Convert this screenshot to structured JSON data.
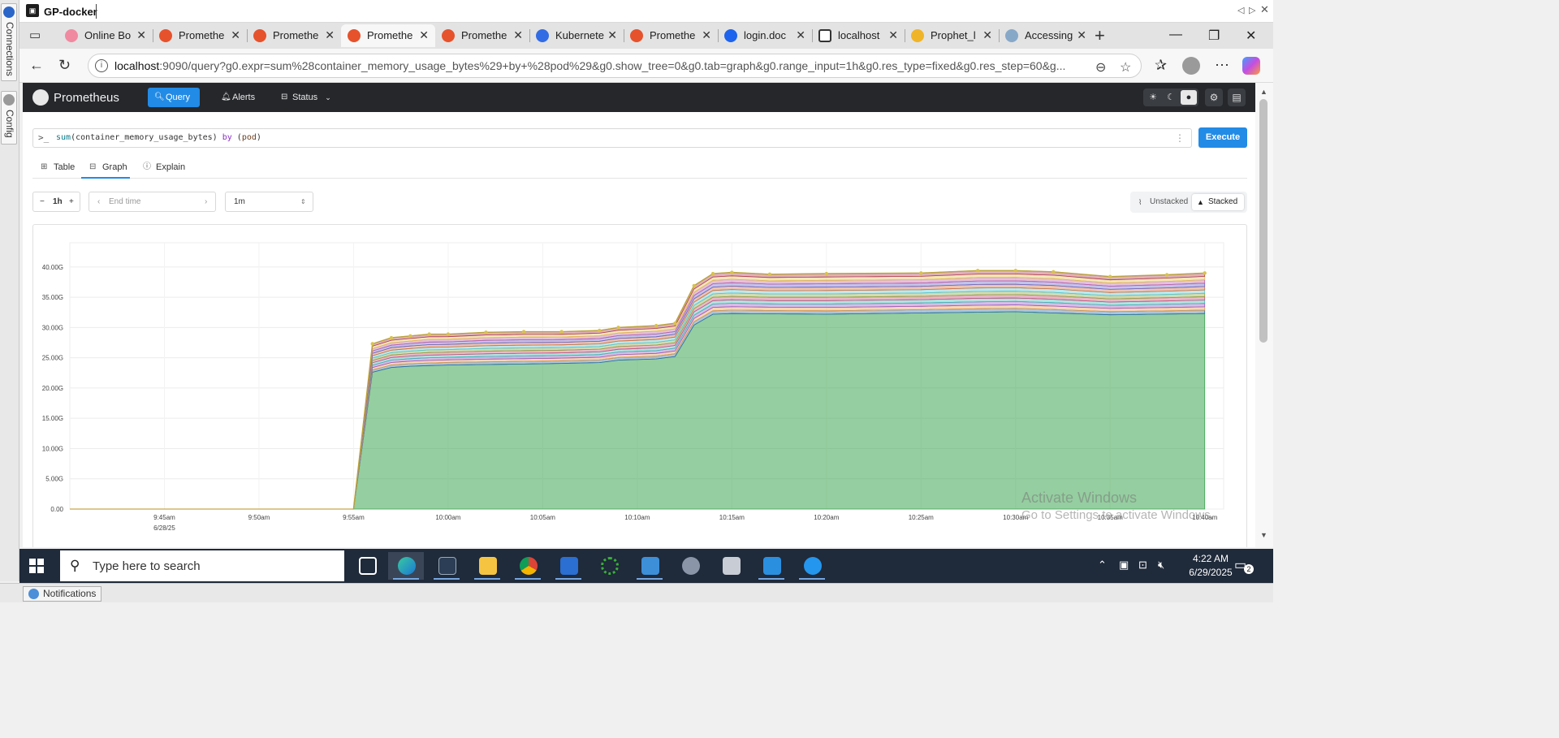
{
  "side_panel": {
    "tabs": [
      "Connections",
      "Config"
    ]
  },
  "window": {
    "title": "GP-docker"
  },
  "browser": {
    "tabs": [
      {
        "label": "Online Bo",
        "icon": "online-icon",
        "active": false
      },
      {
        "label": "Promethe",
        "icon": "prometheus-icon",
        "active": false
      },
      {
        "label": "Promethe",
        "icon": "prometheus-icon",
        "active": false
      },
      {
        "label": "Promethe",
        "icon": "prometheus-icon",
        "active": true
      },
      {
        "label": "Promethe",
        "icon": "prometheus-icon",
        "active": false
      },
      {
        "label": "Kubernete",
        "icon": "kubernetes-icon",
        "active": false
      },
      {
        "label": "Promethe",
        "icon": "prometheus-icon",
        "active": false
      },
      {
        "label": "login.doc",
        "icon": "docker-icon",
        "active": false
      },
      {
        "label": "localhost",
        "icon": "file-icon",
        "active": false
      },
      {
        "label": "Prophet_l",
        "icon": "prophet-icon",
        "active": false
      },
      {
        "label": "Accessing",
        "icon": "accessing-icon",
        "active": false
      }
    ],
    "url_host": "localhost",
    "url_rest": ":9090/query?g0.expr=sum%28container_memory_usage_bytes%29+by+%28pod%29&g0.show_tree=0&g0.tab=graph&g0.range_input=1h&g0.res_type=fixed&g0.res_step=60&g..."
  },
  "prometheus": {
    "brand": "Prometheus",
    "nav": {
      "query": "Query",
      "alerts": "Alerts",
      "status": "Status"
    },
    "expression": {
      "fn": "sum",
      "metric": "(container_memory_usage_bytes)",
      "kw": "by",
      "label": "pod"
    },
    "execute_label": "Execute",
    "tabs": {
      "table": "Table",
      "graph": "Graph",
      "explain": "Explain"
    },
    "range": "1h",
    "end_time_placeholder": "End time",
    "resolution": "1m",
    "stack": {
      "unstacked": "Unstacked",
      "stacked": "Stacked"
    }
  },
  "chart_data": {
    "type": "area",
    "stacked": true,
    "yticks": [
      "0.00",
      "5.00G",
      "10.00G",
      "15.00G",
      "20.00G",
      "25.00G",
      "30.00G",
      "35.00G",
      "40.00G"
    ],
    "ylim": [
      0,
      44
    ],
    "xticks": [
      "9:45am",
      "9:50am",
      "9:55am",
      "10:00am",
      "10:05am",
      "10:10am",
      "10:15am",
      "10:20am",
      "10:25am",
      "10:30am",
      "10:35am",
      "10:40am"
    ],
    "x_date_label": "6/28/25",
    "xlim": [
      "9:40am",
      "10:41am"
    ],
    "total_series": {
      "x": [
        "9:55am",
        "9:56am",
        "9:57am",
        "9:58am",
        "9:59am",
        "10:00am",
        "10:02am",
        "10:04am",
        "10:06am",
        "10:08am",
        "10:09am",
        "10:11am",
        "10:12am",
        "10:13am",
        "10:14am",
        "10:15am",
        "10:17am",
        "10:20am",
        "10:25am",
        "10:28am",
        "10:30am",
        "10:32am",
        "10:35am",
        "10:38am",
        "10:40am"
      ],
      "values": [
        0,
        27.3,
        28.3,
        28.6,
        28.9,
        28.9,
        29.2,
        29.3,
        29.3,
        29.5,
        30.0,
        30.3,
        30.7,
        36.9,
        38.9,
        39.1,
        38.8,
        38.9,
        39.0,
        39.4,
        39.4,
        39.2,
        38.4,
        38.7,
        39.0
      ]
    },
    "dominant_series": {
      "x": [
        "9:55am",
        "9:56am",
        "9:57am",
        "9:58am",
        "10:00am",
        "10:05am",
        "10:08am",
        "10:09am",
        "10:11am",
        "10:12am",
        "10:13am",
        "10:14am",
        "10:15am",
        "10:20am",
        "10:25am",
        "10:30am",
        "10:35am",
        "10:40am"
      ],
      "values": [
        0,
        22.6,
        23.4,
        23.6,
        23.8,
        24.0,
        24.2,
        24.6,
        24.8,
        25.2,
        30.4,
        32.2,
        32.3,
        32.2,
        32.4,
        32.6,
        32.1,
        32.3
      ]
    },
    "series_colors": [
      "#3ea552",
      "#2d6ea8",
      "#e89b4a",
      "#9a59c4",
      "#3dbbb5",
      "#cf4f7a",
      "#8fa842",
      "#58c8d6",
      "#d86e3f",
      "#6a6acb",
      "#c062a8",
      "#e3c24d",
      "#b23a5b"
    ]
  },
  "watermark": {
    "line1": "Activate Windows",
    "line2": "Go to Settings to activate Windows."
  },
  "taskbar": {
    "search_placeholder": "Type here to search",
    "time": "4:22 AM",
    "date": "6/29/2025",
    "notification_count": "2"
  },
  "statusbar": {
    "notifications": "Notifications"
  }
}
